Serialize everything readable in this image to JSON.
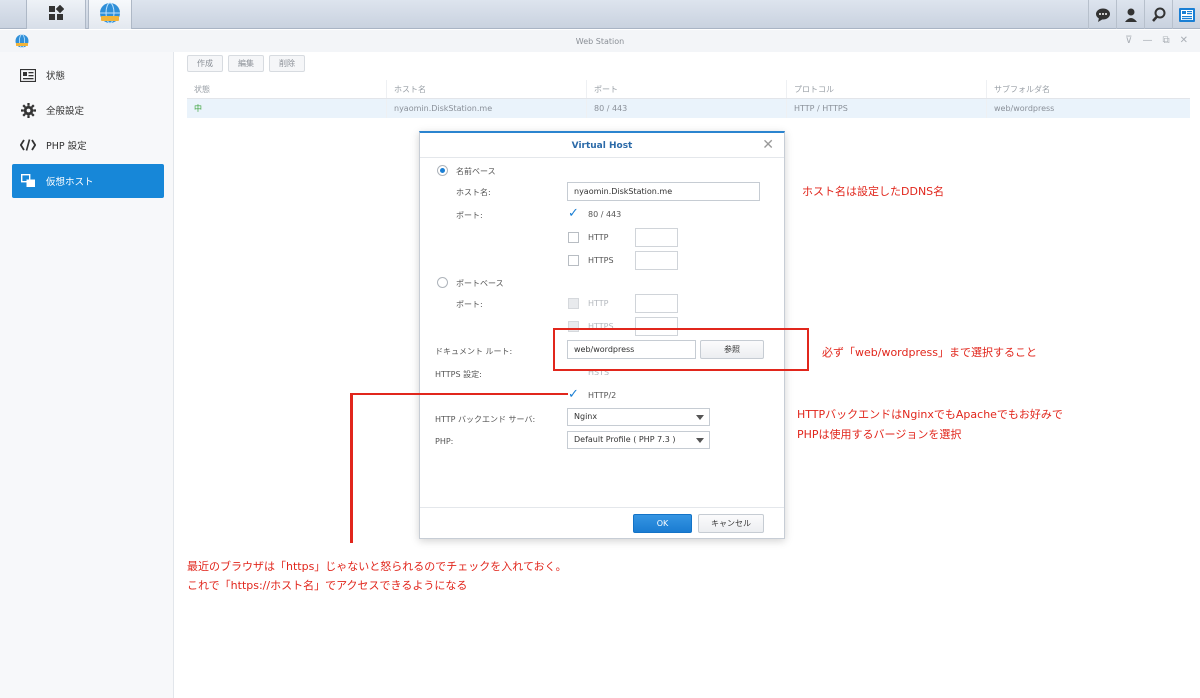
{
  "window": {
    "title": "Web Station"
  },
  "sidebar": {
    "items": [
      {
        "label": "状態",
        "icon": "status-icon"
      },
      {
        "label": "全般設定",
        "icon": "gear-icon"
      },
      {
        "label": "PHP 設定",
        "icon": "code-icon"
      },
      {
        "label": "仮想ホスト",
        "icon": "virtual-host-icon",
        "active": true
      }
    ]
  },
  "toolbar": {
    "create": "作成",
    "edit": "編集",
    "delete": "削除"
  },
  "grid": {
    "columns": [
      "状態",
      "ホスト名",
      "ポート",
      "プロトコル",
      "サブフォルダ名"
    ],
    "rows": [
      {
        "status": "中",
        "host": "nyaomin.DiskStation.me",
        "port": "80 / 443",
        "protocol": "HTTP / HTTPS",
        "folder": "web/wordpress"
      }
    ]
  },
  "dialog": {
    "title": "Virtual Host",
    "name_based": "名前ベース",
    "host_label": "ホスト名:",
    "host_value": "nyaomin.DiskStation.me",
    "port_label": "ポート:",
    "port_80_443": "80 / 443",
    "http": "HTTP",
    "https": "HTTPS",
    "port_based": "ポートベース",
    "port_label2": "ポート:",
    "http2_dim": "HTTP",
    "https2_dim": "HTTPS",
    "docroot_label": "ドキュメント ルート:",
    "docroot_value": "web/wordpress",
    "browse": "参照",
    "https_settings_label": "HTTPS 設定:",
    "hsts": "HSTS",
    "http2": "HTTP/2",
    "backend_label": "HTTP バックエンド サーバ:",
    "backend_value": "Nginx",
    "php_label": "PHP:",
    "php_value": "Default Profile ( PHP 7.3 )",
    "ok": "OK",
    "cancel": "キャンセル"
  },
  "annotations": {
    "hostname_note": "ホスト名は設定したDDNS名",
    "docroot_note": "必ず「web/wordpress」まで選択すること",
    "backend_note1": "HTTPバックエンドはNginxでもApacheでもお好みで",
    "backend_note2": "PHPは使用するバージョンを選択",
    "http2_note1": "最近のブラウザは「https」じゃないと怒られるのでチェックを入れておく。",
    "http2_note2": "これで「https://ホスト名」でアクセスできるようになる",
    "color": "#e1261c"
  },
  "colors": {
    "accent": "#1787d8",
    "dialog_title": "#2b6aa8"
  }
}
